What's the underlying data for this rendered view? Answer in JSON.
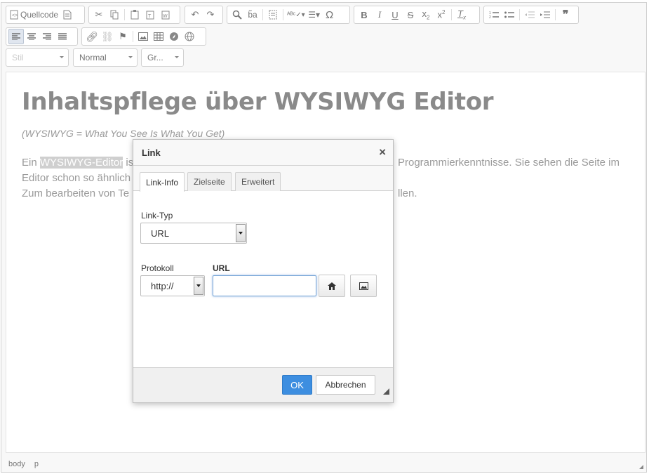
{
  "toolbar": {
    "source_label": "Quellcode",
    "format_style": "Stil",
    "format_block": "Normal",
    "format_size": "Gr..."
  },
  "content": {
    "heading": "Inhaltspflege über WYSIWYG Editor",
    "subtitle": "(WYSIWYG = What You See Is What You Get)",
    "para1_pre": "Ein ",
    "para1_sel": "WYSIWYG-Editor",
    "para1_post": " ist",
    "para1_right": "Programmierkenntnisse. Sie sehen die Seite im",
    "para2": "Editor schon so ähnlich",
    "para3": "Zum bearbeiten von Te",
    "para3_right": "llen."
  },
  "statusbar": {
    "path": [
      "body",
      "p"
    ]
  },
  "dialog": {
    "title": "Link",
    "close": "×",
    "tabs": [
      "Link-Info",
      "Zielseite",
      "Erweitert"
    ],
    "link_type_label": "Link-Typ",
    "link_type_value": "URL",
    "protocol_label": "Protokoll",
    "protocol_value": "http://",
    "url_label": "URL",
    "url_value": "",
    "ok": "OK",
    "cancel": "Abbrechen"
  }
}
